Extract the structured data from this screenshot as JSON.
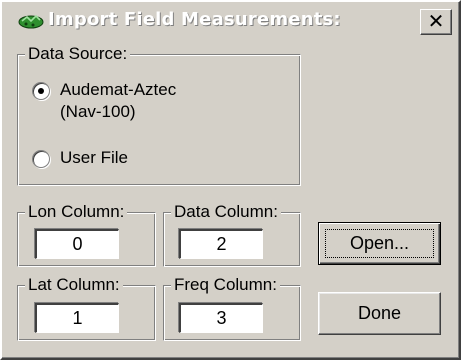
{
  "window": {
    "title": "Import Field Measurements:",
    "close_glyph": "✕",
    "icon": "import-icon"
  },
  "data_source": {
    "legend": "Data Source:",
    "options": [
      {
        "line1": "Audemat-Aztec",
        "line2": "(Nav-100)",
        "checked": true
      },
      {
        "line1": "User File",
        "line2": "",
        "checked": false
      }
    ]
  },
  "columns": {
    "lon": {
      "label": "Lon Column:",
      "value": "0"
    },
    "data": {
      "label": "Data Column:",
      "value": "2"
    },
    "lat": {
      "label": "Lat Column:",
      "value": "1"
    },
    "freq": {
      "label": "Freq Column:",
      "value": "3"
    }
  },
  "buttons": {
    "open": "Open...",
    "done": "Done"
  },
  "colors": {
    "face": "#d4d0c8",
    "highlight": "#ffffff",
    "shadow": "#808080",
    "dark_shadow": "#404040",
    "icon_green": "#2f8f2f"
  }
}
